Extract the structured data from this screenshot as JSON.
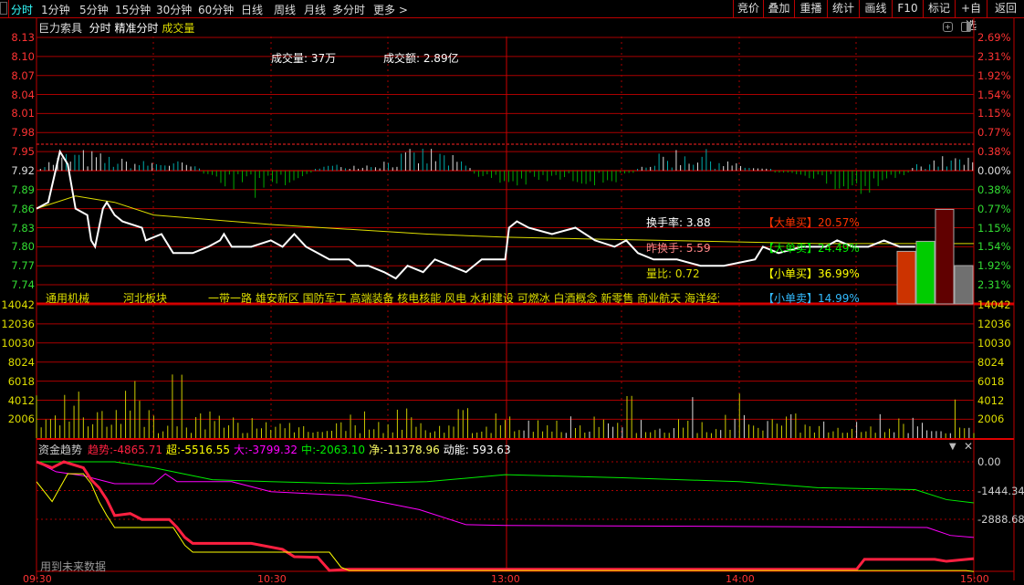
{
  "topbar": {
    "tabs": [
      "分时",
      "1分钟",
      "5分钟",
      "15分钟",
      "30分钟",
      "60分钟",
      "日线",
      "周线",
      "月线",
      "多分时",
      "更多 >"
    ],
    "buttons": [
      "竞价",
      "叠加",
      "重播",
      "统计",
      "画线",
      "F10",
      "标记",
      "+自选",
      "返回"
    ]
  },
  "header": {
    "stock": "巨力索具",
    "mode1": "分时",
    "mode2": "精准分时",
    "indicator": "成交量"
  },
  "summary": {
    "volume": "成交量: 37万",
    "amount": "成交额: 2.89亿"
  },
  "stats": {
    "turnover": "换手率: 3.88",
    "prev_turnover": "昨换手: 5.59",
    "volume_ratio": "量比: 0.72"
  },
  "orders": [
    {
      "label": "【大单买】",
      "value": "20.57%",
      "pct": 20.57,
      "color": "#ff3300",
      "bar": "#cc3300"
    },
    {
      "label": "【大单卖】",
      "value": "24.49%",
      "pct": 24.49,
      "color": "#00ee00",
      "bar": "#00cc00"
    },
    {
      "label": "【小单买】",
      "value": "36.99%",
      "pct": 36.99,
      "color": "#ffff00",
      "bar": "#600000"
    },
    {
      "label": "【小单卖】",
      "value": "14.99%",
      "pct": 14.99,
      "color": "#33bbff",
      "bar": "#707070"
    }
  ],
  "sectors": {
    "industry": "通用机械",
    "region": "河北板块",
    "concepts": "一带一路 雄安新区 国防军工 高端装备 核电核能 风电 水利建设 可燃冰 白酒概念 新零售 商业航天 海洋经济"
  },
  "price_axis": {
    "left": [
      "8.13",
      "8.10",
      "8.07",
      "8.04",
      "8.01",
      "7.98",
      "7.95",
      "7.92",
      "7.89",
      "7.86",
      "7.83",
      "7.80",
      "7.77",
      "7.74"
    ],
    "right": [
      "2.69%",
      "2.31%",
      "1.92%",
      "1.54%",
      "1.15%",
      "0.77%",
      "0.38%",
      "0.00%",
      "0.38%",
      "0.77%",
      "1.15%",
      "1.54%",
      "1.92%",
      "2.31%"
    ]
  },
  "volume_axis": [
    "14042",
    "12036",
    "10030",
    "8024",
    "6018",
    "4012",
    "2006"
  ],
  "fund": {
    "title": "资金趋势",
    "legend": [
      {
        "label": "趋势",
        "value": ":-4865.71",
        "color": "#ff2040"
      },
      {
        "label": "超",
        "value": ":-5516.55",
        "color": "#ffff00"
      },
      {
        "label": "大",
        "value": ":-3799.32",
        "color": "#ff00ff"
      },
      {
        "label": "中",
        "value": ":-2063.10",
        "color": "#00ee00"
      },
      {
        "label": "净",
        "value": ":-11378.96",
        "color": "#ffff66"
      },
      {
        "label": "动能",
        "value": ": 593.63",
        "color": "#ffffff"
      }
    ],
    "axis": [
      "0.00",
      "-1444.34",
      "-2888.68"
    ],
    "note": "用到未来数据"
  },
  "time_axis": [
    "09:30",
    "10:30",
    "13:00",
    "14:00",
    "15:00"
  ],
  "chart_data": {
    "type": "line",
    "prev_close": 7.92,
    "price": [
      [
        0,
        7.86
      ],
      [
        3,
        7.87
      ],
      [
        6,
        7.95
      ],
      [
        8,
        7.93
      ],
      [
        10,
        7.86
      ],
      [
        13,
        7.85
      ],
      [
        14,
        7.81
      ],
      [
        15,
        7.8
      ],
      [
        17,
        7.86
      ],
      [
        18,
        7.87
      ],
      [
        20,
        7.85
      ],
      [
        22,
        7.84
      ],
      [
        27,
        7.83
      ],
      [
        28,
        7.81
      ],
      [
        32,
        7.82
      ],
      [
        35,
        7.79
      ],
      [
        40,
        7.79
      ],
      [
        44,
        7.8
      ],
      [
        47,
        7.81
      ],
      [
        48,
        7.82
      ],
      [
        50,
        7.8
      ],
      [
        55,
        7.8
      ],
      [
        60,
        7.81
      ],
      [
        63,
        7.8
      ],
      [
        66,
        7.82
      ],
      [
        69,
        7.8
      ],
      [
        72,
        7.79
      ],
      [
        75,
        7.78
      ],
      [
        80,
        7.78
      ],
      [
        82,
        7.77
      ],
      [
        85,
        7.77
      ],
      [
        89,
        7.76
      ],
      [
        92,
        7.75
      ],
      [
        95,
        7.77
      ],
      [
        99,
        7.76
      ],
      [
        102,
        7.78
      ],
      [
        106,
        7.77
      ],
      [
        110,
        7.76
      ],
      [
        114,
        7.78
      ],
      [
        120,
        7.78
      ],
      [
        121,
        7.83
      ],
      [
        123,
        7.84
      ],
      [
        126,
        7.83
      ],
      [
        132,
        7.82
      ],
      [
        138,
        7.83
      ],
      [
        143,
        7.81
      ],
      [
        148,
        7.8
      ],
      [
        151,
        7.81
      ],
      [
        154,
        7.79
      ],
      [
        158,
        7.78
      ],
      [
        164,
        7.78
      ],
      [
        170,
        7.77
      ],
      [
        176,
        7.77
      ],
      [
        184,
        7.78
      ],
      [
        186,
        7.8
      ],
      [
        190,
        7.79
      ],
      [
        196,
        7.8
      ],
      [
        202,
        7.8
      ],
      [
        205,
        7.81
      ],
      [
        209,
        7.8
      ],
      [
        213,
        7.8
      ],
      [
        217,
        7.81
      ],
      [
        221,
        7.8
      ],
      [
        225,
        7.8
      ]
    ],
    "avg": [
      [
        0,
        7.86
      ],
      [
        10,
        7.88
      ],
      [
        20,
        7.87
      ],
      [
        30,
        7.85
      ],
      [
        60,
        7.835
      ],
      [
        100,
        7.82
      ],
      [
        120,
        7.815
      ],
      [
        160,
        7.81
      ],
      [
        200,
        7.805
      ],
      [
        240,
        7.805
      ]
    ],
    "fund_series": {
      "trend": [
        [
          0,
          0
        ],
        [
          4,
          -300
        ],
        [
          7,
          0
        ],
        [
          12,
          -300
        ],
        [
          14,
          -900
        ],
        [
          16,
          -1300
        ],
        [
          18,
          -1900
        ],
        [
          20,
          -2700
        ],
        [
          24,
          -2600
        ],
        [
          27,
          -2900
        ],
        [
          34,
          -2900
        ],
        [
          36,
          -3300
        ],
        [
          38,
          -3800
        ],
        [
          40,
          -4100
        ],
        [
          55,
          -4100
        ],
        [
          63,
          -4400
        ],
        [
          66,
          -4770
        ],
        [
          72,
          -4800
        ],
        [
          75,
          -5460
        ],
        [
          80,
          -5400
        ],
        [
          210,
          -5400
        ],
        [
          212,
          -4900
        ],
        [
          230,
          -4900
        ],
        [
          233,
          -5000
        ],
        [
          240,
          -4865
        ]
      ],
      "super": [
        [
          0,
          -1000
        ],
        [
          4,
          -2000
        ],
        [
          8,
          -600
        ],
        [
          12,
          -600
        ],
        [
          14,
          -1100
        ],
        [
          16,
          -2000
        ],
        [
          18,
          -2700
        ],
        [
          20,
          -3300
        ],
        [
          35,
          -3300
        ],
        [
          38,
          -4200
        ],
        [
          40,
          -4540
        ],
        [
          75,
          -4540
        ],
        [
          78,
          -5300
        ],
        [
          80,
          -5460
        ],
        [
          238,
          -5460
        ],
        [
          240,
          -5516
        ]
      ],
      "big": [
        [
          0,
          0
        ],
        [
          5,
          -500
        ],
        [
          12,
          -700
        ],
        [
          20,
          -1100
        ],
        [
          30,
          -1100
        ],
        [
          33,
          -600
        ],
        [
          36,
          -1000
        ],
        [
          50,
          -1000
        ],
        [
          60,
          -1500
        ],
        [
          80,
          -1700
        ],
        [
          98,
          -2400
        ],
        [
          110,
          -3160
        ],
        [
          120,
          -3200
        ],
        [
          180,
          -3250
        ],
        [
          228,
          -3300
        ],
        [
          234,
          -3700
        ],
        [
          240,
          -3799
        ]
      ],
      "mid": [
        [
          0,
          0
        ],
        [
          20,
          0
        ],
        [
          30,
          -300
        ],
        [
          45,
          -900
        ],
        [
          60,
          -1000
        ],
        [
          80,
          -1100
        ],
        [
          100,
          -1000
        ],
        [
          120,
          -650
        ],
        [
          150,
          -800
        ],
        [
          180,
          -1000
        ],
        [
          200,
          -1300
        ],
        [
          225,
          -1400
        ],
        [
          233,
          -1900
        ],
        [
          240,
          -2063
        ]
      ]
    }
  }
}
